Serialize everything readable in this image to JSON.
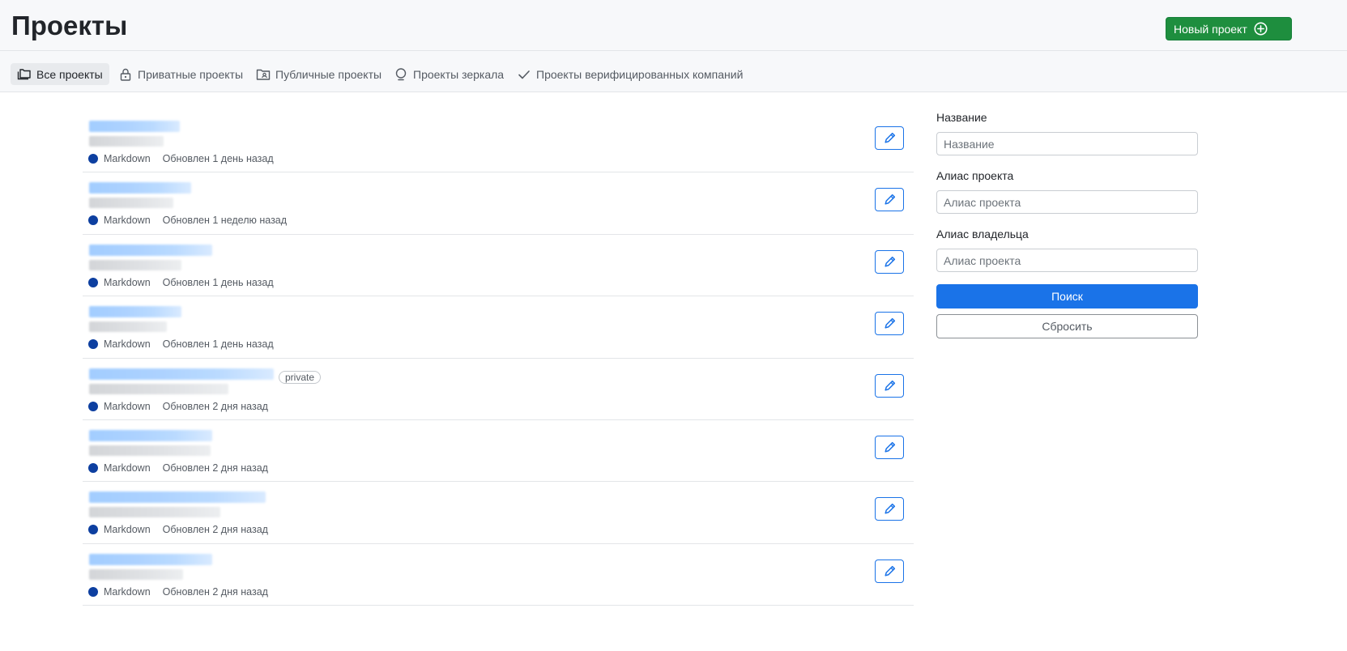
{
  "header": {
    "title": "Проекты",
    "new_project_label": "Новый проект"
  },
  "tabs": [
    {
      "label": "Все проекты",
      "icon": "folders-icon",
      "active": true
    },
    {
      "label": "Приватные проекты",
      "icon": "lock-icon",
      "active": false
    },
    {
      "label": "Публичные проекты",
      "icon": "public-folder-icon",
      "active": false
    },
    {
      "label": "Проекты зеркала",
      "icon": "mirror-icon",
      "active": false
    },
    {
      "label": "Проекты верифицированных компаний",
      "icon": "check-icon",
      "active": false
    }
  ],
  "projects": [
    {
      "language": "Markdown",
      "updated": "Обновлен 1 день назад"
    },
    {
      "language": "Markdown",
      "updated": "Обновлен 1 неделю назад"
    },
    {
      "language": "Markdown",
      "updated": "Обновлен 1 день назад"
    },
    {
      "language": "Markdown",
      "updated": "Обновлен 1 день назад"
    },
    {
      "language": "Markdown",
      "updated": "Обновлен 2 дня назад",
      "badge": "private"
    },
    {
      "language": "Markdown",
      "updated": "Обновлен 2 дня назад"
    },
    {
      "language": "Markdown",
      "updated": "Обновлен 2 дня назад"
    },
    {
      "language": "Markdown",
      "updated": "Обновлен 2 дня назад"
    }
  ],
  "filters": {
    "name_label": "Название",
    "name_placeholder": "Название",
    "alias_label": "Алиас проекта",
    "alias_placeholder": "Алиас проекта",
    "owner_label": "Алиас владельца",
    "owner_placeholder": "Алиас проекта",
    "search_label": "Поиск",
    "reset_label": "Сбросить"
  },
  "colors": {
    "primary": "#1a73e8",
    "success": "#1e8e3e",
    "markdown_dot": "#0d3fa0"
  }
}
